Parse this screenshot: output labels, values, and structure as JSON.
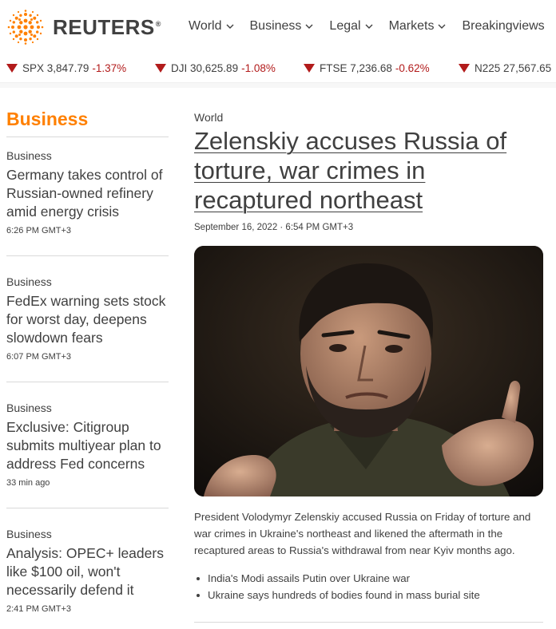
{
  "header": {
    "logo_text": "REUTERS",
    "logo_mark": "®",
    "nav": [
      {
        "label": "World",
        "has_dropdown": true
      },
      {
        "label": "Business",
        "has_dropdown": true
      },
      {
        "label": "Legal",
        "has_dropdown": true
      },
      {
        "label": "Markets",
        "has_dropdown": true
      },
      {
        "label": "Breakingviews",
        "has_dropdown": false
      }
    ]
  },
  "ticker": [
    {
      "name": "SPX",
      "value": "3,847.79",
      "change": "-1.37%",
      "direction": "down"
    },
    {
      "name": "DJI",
      "value": "30,625.89",
      "change": "-1.08%",
      "direction": "down"
    },
    {
      "name": "FTSE",
      "value": "7,236.68",
      "change": "-0.62%",
      "direction": "down"
    },
    {
      "name": "N225",
      "value": "27,567.65",
      "change": "",
      "direction": "down"
    }
  ],
  "colors": {
    "accent": "#ff8000",
    "down": "#b21b1b",
    "text": "#404040",
    "rule": "#d9d9d9"
  },
  "sidebar": {
    "title": "Business",
    "items": [
      {
        "category": "Business",
        "headline": "Germany takes control of Russian-owned refinery amid energy crisis",
        "time": "6:26 PM GMT+3"
      },
      {
        "category": "Business",
        "headline": "FedEx warning sets stock for worst day, deepens slowdown fears",
        "time": "6:07 PM GMT+3"
      },
      {
        "category": "Business",
        "headline": "Exclusive: Citigroup submits multiyear plan to address Fed concerns",
        "time": "33 min ago"
      },
      {
        "category": "Business",
        "headline": "Analysis: OPEC+ leaders like $100 oil, won't necessarily defend it",
        "time": "2:41 PM GMT+3"
      }
    ]
  },
  "article": {
    "category": "World",
    "title": "Zelenskiy accuses Russia of torture, war crimes in recaptured northeast",
    "date": "September 16, 2022 · 6:54 PM GMT+3",
    "summary": "President Volodymyr Zelenskiy accused Russia on Friday of torture and war crimes in Ukraine's northeast and likened the aftermath in the recaptured areas to Russia's withdrawal from near Kyiv months ago.",
    "related": [
      "India's Modi assails Putin over Ukraine war",
      "Ukraine says hundreds of bodies found in mass burial site"
    ]
  }
}
